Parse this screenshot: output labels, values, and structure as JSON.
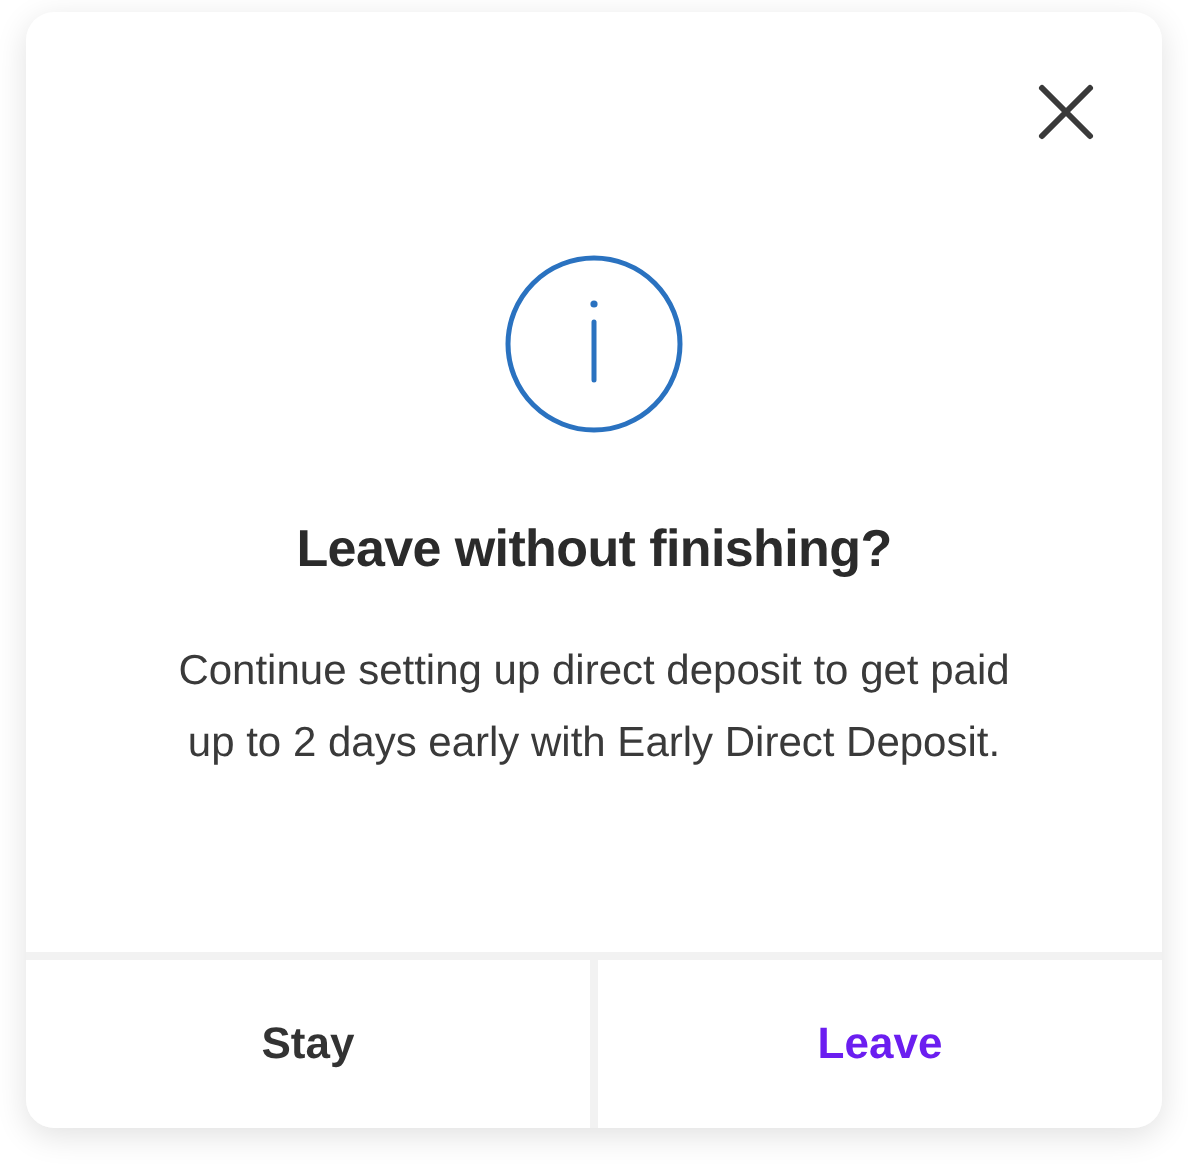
{
  "dialog": {
    "title": "Leave without finishing?",
    "message": "Continue setting up direct deposit to get paid up to 2 days early with Early Direct Deposit.",
    "buttons": [
      {
        "label": "Stay",
        "kind": "secondary"
      },
      {
        "label": "Leave",
        "kind": "primary"
      }
    ]
  }
}
